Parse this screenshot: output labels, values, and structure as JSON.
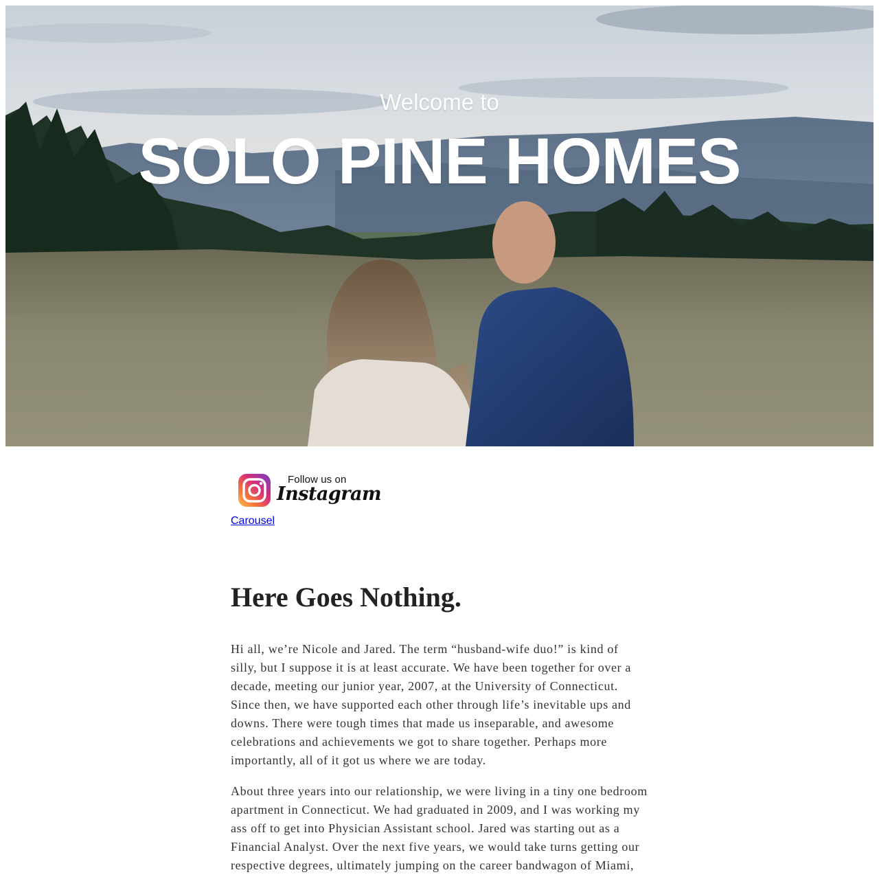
{
  "hero": {
    "welcome": "Welcome to",
    "title": "SOLO PINE HOMES",
    "image": "couple-in-mountain-meadow-photo"
  },
  "instagram": {
    "follow_text": "Follow us on",
    "brand_text": "Instagram",
    "icon": "instagram-icon"
  },
  "links": {
    "carousel": "Carousel"
  },
  "post": {
    "title": "Here Goes Nothing.",
    "paragraphs": [
      "Hi all, we’re Nicole and Jared. The term “husband-wife duo!” is kind of silly, but I suppose it is at least accurate. We have been together for over a decade, meeting our junior year, 2007, at the University of Connecticut. Since then, we have supported each other through life’s inevitable ups and downs. There were tough times that made us inseparable, and awesome celebrations and achievements we got to share together. Perhaps more importantly, all of it got us where we are today.",
      "About three years into our relationship, we were living in a tiny one bedroom apartment in Connecticut. We had graduated in 2009, and I was working my ass off to get into Physician Assistant school. Jared was starting out as a Financial Analyst. Over the next five years, we would take turns getting our respective degrees, ultimately jumping on the career bandwagon of Miami, realizing fast all is fine..."
    ]
  },
  "colors": {
    "link": "#0000ee",
    "heading": "#222222",
    "body_text": "#333333",
    "hero_text": "#ffffff"
  }
}
